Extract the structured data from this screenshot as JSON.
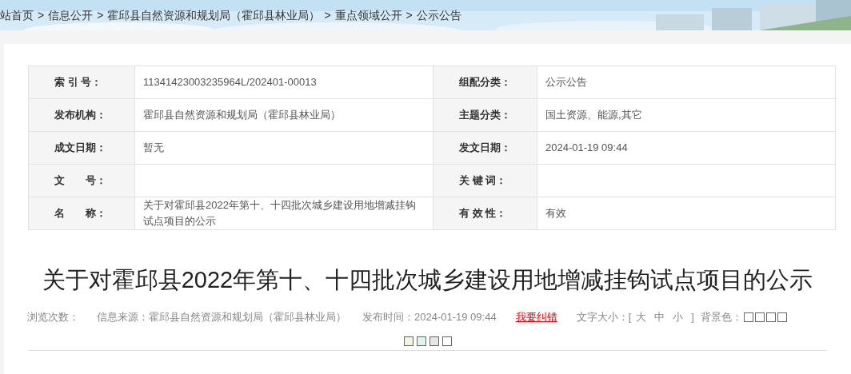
{
  "breadcrumb": [
    "站首页",
    "信息公开",
    "霍邱县自然资源和规划局（霍邱县林业局）",
    "重点领域公开",
    "公示公告"
  ],
  "breadcrumb_separators": [
    ">",
    ">",
    ">",
    ">"
  ],
  "info_table": [
    {
      "label": "索 引 号：",
      "value": "11341423003235964L/202401-00013",
      "label2": "组配分类：",
      "value2": "公示公告"
    },
    {
      "label": "发布机构：",
      "value": "霍邱县自然资源和规划局（霍邱县林业局）",
      "label2": "主题分类：",
      "value2": "国土资源、能源,其它"
    },
    {
      "label": "成文日期：",
      "value": "暂无",
      "label2": "发文日期：",
      "value2": "2024-01-19 09:44"
    },
    {
      "label": "文　　号：",
      "label2": "关 键 词："
    },
    {
      "label": "名　　称：",
      "value": "关于对霍邱县2022年第十、十四批次城乡建设用地增减挂钩试点项目的公示",
      "label2": "有 效 性：",
      "value2": "有效"
    }
  ],
  "title": "关于对霍邱县2022年第十、十四批次城乡建设用地增减挂钩试点项目的公示",
  "meta": {
    "views": "浏览次数：",
    "source": "信息来源：霍邱县自然资源和规划局（霍邱县林业局）",
    "published": "发布时间：2024-01-19 09:44",
    "report_link": "我要纠错",
    "font_size_label": "文字大小：[",
    "font_sizes": [
      "大",
      "中",
      "小"
    ],
    "font_size_end": "]",
    "background_label": "背景色："
  },
  "background_swatches": [
    {
      "color": "#ffffff"
    },
    {
      "color": "#ffffff"
    },
    {
      "color": "#ffffff"
    },
    {
      "color": "#ffffff"
    },
    {
      "color": "#eef7e0"
    },
    {
      "color": "#def4ef"
    },
    {
      "color": "#e6e6e6"
    },
    {
      "color": "#ffffff"
    }
  ]
}
